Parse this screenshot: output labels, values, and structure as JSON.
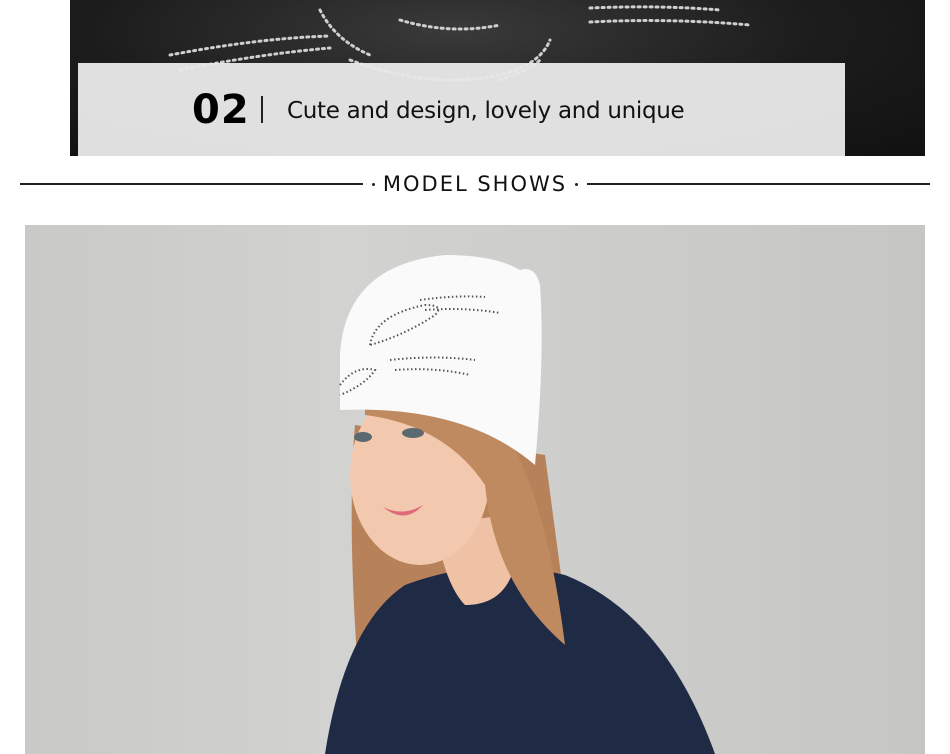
{
  "detail_section": {
    "number": "02",
    "caption": "Cute and design, lovely and unique"
  },
  "divider": {
    "title": "MODEL SHOWS"
  },
  "colors": {
    "caption_band": "#e8e8e8",
    "hat_black": "#1c1c1c",
    "hat_white": "#fafafa",
    "background_gray": "#cbcbc9",
    "sweater_navy": "#1f2a44",
    "hair_auburn": "#b9825a"
  }
}
